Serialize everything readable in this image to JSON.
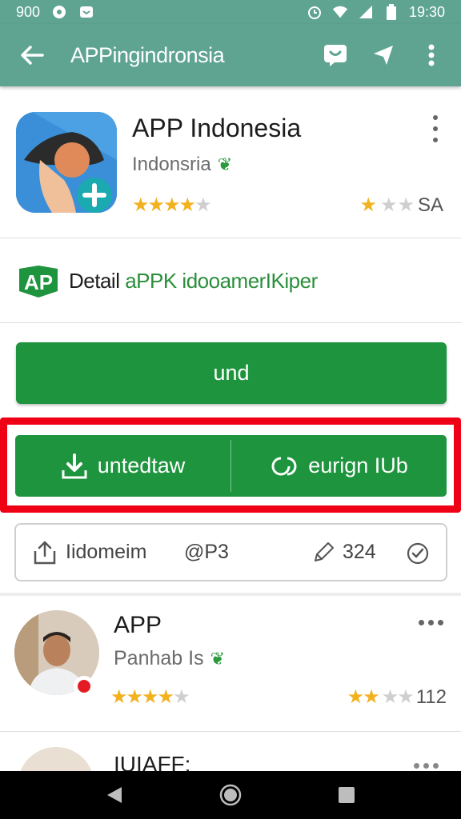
{
  "status_bar": {
    "left_text": "900",
    "time": "19:30"
  },
  "app_bar": {
    "title": "APPingindronsia",
    "back_icon": "arrow-back-icon",
    "actions": [
      "chat-icon",
      "send-icon",
      "more-vert-icon"
    ]
  },
  "app": {
    "name": "APP Indonesia",
    "developer": "Indonsria",
    "rating_left": "★★★★",
    "rating_right_label": "SA"
  },
  "detail": {
    "logo_text": "AP",
    "label_dark": "Detail",
    "label_green": " aPPK idooamerIKiper"
  },
  "buttons": {
    "primary": "und",
    "split_left": "untedtaw",
    "split_right": "eurign IUb"
  },
  "action_strip": {
    "share_label": "Iidomeim",
    "mid_label": "@P3",
    "count_label": "324"
  },
  "reviews": [
    {
      "name": "APP",
      "subtitle": "Panhab Is",
      "rating_right_count": "112"
    },
    {
      "name": "IUIAFF:"
    }
  ],
  "colors": {
    "app_bar": "#5fa491",
    "primary_green": "#1f943e",
    "highlight_red": "#f00014",
    "star_gold": "#f2b11f"
  }
}
